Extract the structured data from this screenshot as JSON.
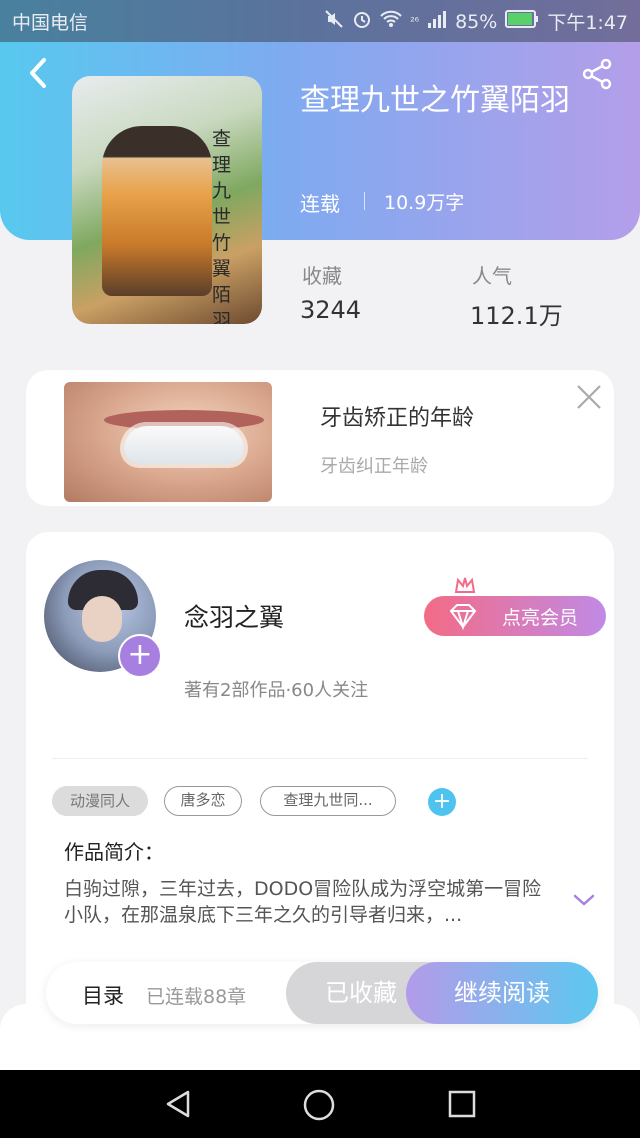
{
  "status_bar": {
    "carrier": "中国电信",
    "network": "²⁶",
    "battery": "85%",
    "time": "下午1:47"
  },
  "book": {
    "title": "查理九世之竹翼陌羽",
    "cover_vertical_text": "查理九世竹翼陌羽",
    "status": "连载",
    "word_count": "10.9万字",
    "stats": [
      {
        "label": "收藏",
        "value": "3244"
      },
      {
        "label": "人气",
        "value": "112.1万"
      }
    ]
  },
  "ad": {
    "title": "牙齿矫正的年龄",
    "subtitle": "牙齿纠正年龄"
  },
  "author": {
    "name": "念羽之翼",
    "info": "著有2部作品·60人关注",
    "vip_label": "点亮会员"
  },
  "tags": [
    "动漫同人",
    "唐多恋",
    "查理九世同..."
  ],
  "intro": {
    "label": "作品简介：",
    "text": "白驹过隙，三年过去，DODO冒险队成为浮空城第一冒险小队，在那温泉底下三年之久的引导者归来，..."
  },
  "action_bar": {
    "toc": "目录",
    "chapters": "已连载88章",
    "collected": "已收藏",
    "continue": "继续阅读"
  },
  "colors": {
    "gradient_start": "#57c9ef",
    "gradient_end": "#b49ee9",
    "accent_purple": "#a77fe0",
    "accent_blue": "#4fc3ef"
  }
}
